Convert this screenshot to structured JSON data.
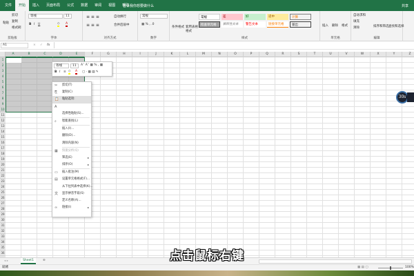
{
  "tabs": [
    "文件",
    "开始",
    "插入",
    "页面布局",
    "公式",
    "数据",
    "审阅",
    "视图",
    "帮助"
  ],
  "active_tab": 1,
  "tell_me": "告诉我你想要做什么",
  "share": "共享",
  "ribbon": {
    "clipboard": {
      "paste": "粘贴",
      "cut": "剪切",
      "copy": "复制",
      "format_painter": "格式刷",
      "label": "剪贴板"
    },
    "font": {
      "name": "等线",
      "size": "11",
      "label": "字体"
    },
    "alignment": {
      "wrap": "自动换行",
      "merge": "合并后居中",
      "label": "对齐方式"
    },
    "number": {
      "format": "常规",
      "label": "数字"
    },
    "styles": {
      "conditional": "条件格式",
      "table": "套用表格格式",
      "items": [
        "常规",
        "差",
        "好",
        "适中",
        "计算",
        "检查单元格",
        "解释性文本",
        "警告文本",
        "链接单元格",
        "输出"
      ],
      "label": "样式"
    },
    "cells": {
      "insert": "插入",
      "delete": "删除",
      "format": "格式",
      "label": "单元格"
    },
    "editing": {
      "autosum": "自动求和",
      "fill": "填充",
      "clear": "清除",
      "sort": "排序和筛选",
      "find": "查找和选择",
      "label": "编辑"
    }
  },
  "name_box": "A1",
  "formula_icons": [
    "×",
    "✓",
    "fx"
  ],
  "columns": [
    "A",
    "B",
    "C",
    "D",
    "E",
    "F",
    "G",
    "H",
    "I",
    "J",
    "K",
    "L",
    "M",
    "N",
    "O",
    "P",
    "Q",
    "R",
    "S",
    "T",
    "U",
    "V",
    "W",
    "X",
    "Y",
    "Z"
  ],
  "rows": 36,
  "mini_toolbar": {
    "font": "等线",
    "size": "11"
  },
  "context_menu": [
    {
      "label": "剪切(T)",
      "icon": "✂"
    },
    {
      "label": "复制(C)",
      "icon": "⎘"
    },
    {
      "label": "粘贴选项:",
      "icon": "📋",
      "hl": true
    },
    {
      "label": "",
      "icon": "A"
    },
    {
      "label": "选择性粘贴(S)...",
      "icon": ""
    },
    {
      "sep": true
    },
    {
      "label": "智能查找(L)",
      "icon": "⌕"
    },
    {
      "sep": true
    },
    {
      "label": "插入(I)...",
      "icon": ""
    },
    {
      "label": "删除(D)...",
      "icon": ""
    },
    {
      "label": "清除内容(N)",
      "icon": ""
    },
    {
      "sep": true
    },
    {
      "label": "快速分析(Q)",
      "icon": "▦",
      "dis": true
    },
    {
      "label": "筛选(E)",
      "icon": "",
      "arrow": true
    },
    {
      "label": "排序(O)",
      "icon": "",
      "arrow": true
    },
    {
      "sep": true
    },
    {
      "label": "插入批注(M)",
      "icon": "▭"
    },
    {
      "label": "设置单元格格式(F)...",
      "icon": "▤"
    },
    {
      "label": "从下拉列表中选择(K)...",
      "icon": ""
    },
    {
      "label": "显示拼音字段(S)",
      "icon": "文"
    },
    {
      "label": "定义名称(A)...",
      "icon": ""
    },
    {
      "label": "链接(I)",
      "icon": "∞",
      "arrow": true
    }
  ],
  "sheet_tab": "Sheet1",
  "status": "就绪",
  "zoom": "100%",
  "subtitle": "点击鼠标右键",
  "badge": "30s",
  "colors": {
    "brand": "#217346"
  }
}
